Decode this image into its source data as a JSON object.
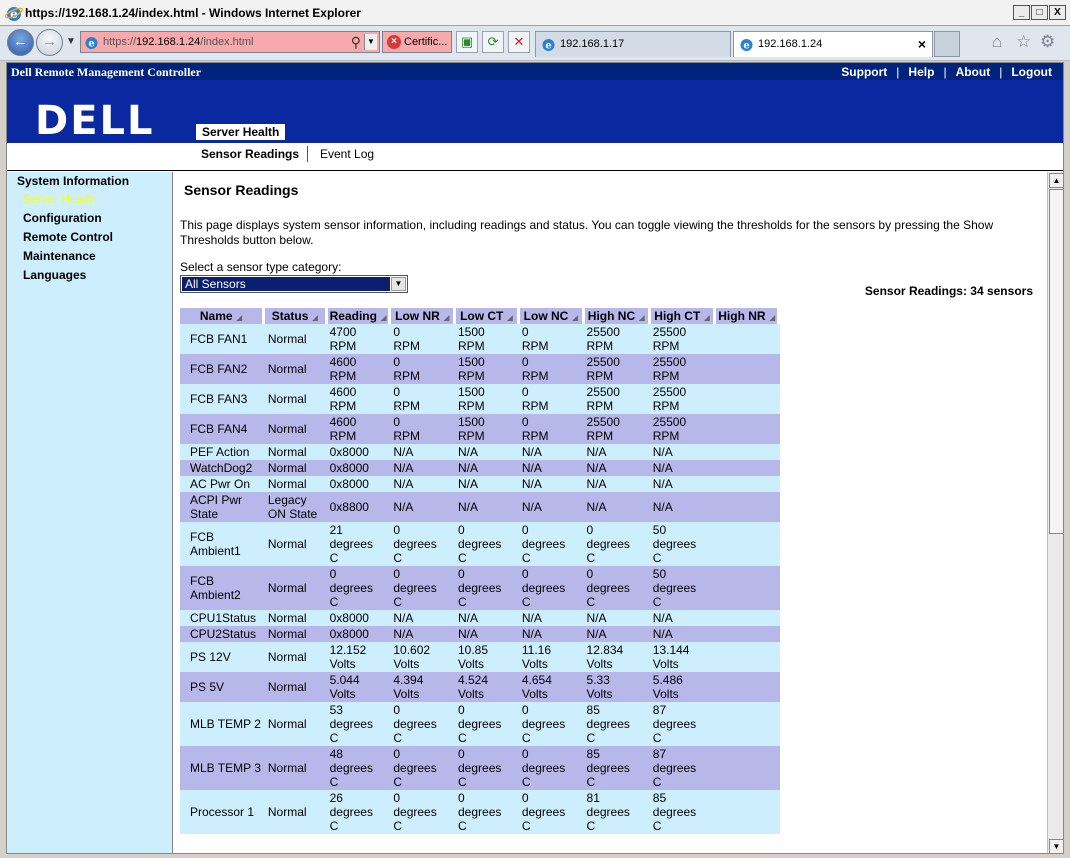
{
  "window": {
    "title": "https://192.168.1.24/index.html - Windows Internet Explorer",
    "minimize": "_",
    "maximize": "□",
    "close": "X"
  },
  "browser": {
    "url_prefix": "https://",
    "url_host": "192.168.1.24",
    "url_path": "/index.html",
    "cert_label": "Certific...",
    "tabs": [
      {
        "label": "192.168.1.17"
      },
      {
        "label": "192.168.1.24"
      }
    ]
  },
  "drmc": {
    "brand": "Dell Remote Management Controller",
    "links": [
      "Support",
      "Help",
      "About",
      "Logout"
    ],
    "logo": "DELL",
    "active_section": "Server Health",
    "subnav": [
      "Sensor Readings",
      "Event Log"
    ]
  },
  "leftnav": [
    {
      "label": "System Information"
    },
    {
      "label": "Server Health"
    },
    {
      "label": "Configuration"
    },
    {
      "label": "Remote Control"
    },
    {
      "label": "Maintenance"
    },
    {
      "label": "Languages"
    }
  ],
  "content": {
    "title": "Sensor Readings",
    "description": "This page displays system sensor information, including readings and status. You can toggle viewing the thresholds for the sensors by pressing the Show Thresholds button below.",
    "select_label": "Select a sensor type category:",
    "select_value": "All Sensors",
    "count_label": "Sensor Readings: 34 sensors"
  },
  "table": {
    "columns": [
      "Name",
      "Status",
      "Reading",
      "Low NR",
      "Low CT",
      "Low NC",
      "High NC",
      "High CT",
      "High NR"
    ],
    "rows": [
      [
        "FCB FAN1",
        "Normal",
        "4700 RPM",
        "0 RPM",
        "1500 RPM",
        "0 RPM",
        "25500 RPM",
        "25500 RPM"
      ],
      [
        "FCB FAN2",
        "Normal",
        "4600 RPM",
        "0 RPM",
        "1500 RPM",
        "0 RPM",
        "25500 RPM",
        "25500 RPM"
      ],
      [
        "FCB FAN3",
        "Normal",
        "4600 RPM",
        "0 RPM",
        "1500 RPM",
        "0 RPM",
        "25500 RPM",
        "25500 RPM"
      ],
      [
        "FCB FAN4",
        "Normal",
        "4600 RPM",
        "0 RPM",
        "1500 RPM",
        "0 RPM",
        "25500 RPM",
        "25500 RPM"
      ],
      [
        "PEF Action",
        "Normal",
        "0x8000",
        "N/A",
        "N/A",
        "N/A",
        "N/A",
        "N/A"
      ],
      [
        "WatchDog2",
        "Normal",
        "0x8000",
        "N/A",
        "N/A",
        "N/A",
        "N/A",
        "N/A"
      ],
      [
        "AC Pwr On",
        "Normal",
        "0x8000",
        "N/A",
        "N/A",
        "N/A",
        "N/A",
        "N/A"
      ],
      [
        "ACPI Pwr State",
        "Legacy ON State",
        "0x8800",
        "N/A",
        "N/A",
        "N/A",
        "N/A",
        "N/A"
      ],
      [
        "FCB Ambient1",
        "Normal",
        "21 degrees C",
        "0 degrees C",
        "0 degrees C",
        "0 degrees C",
        "0 degrees C",
        "50 degrees C"
      ],
      [
        "FCB Ambient2",
        "Normal",
        "0 degrees C",
        "0 degrees C",
        "0 degrees C",
        "0 degrees C",
        "0 degrees C",
        "50 degrees C"
      ],
      [
        "CPU1Status",
        "Normal",
        "0x8000",
        "N/A",
        "N/A",
        "N/A",
        "N/A",
        "N/A"
      ],
      [
        "CPU2Status",
        "Normal",
        "0x8000",
        "N/A",
        "N/A",
        "N/A",
        "N/A",
        "N/A"
      ],
      [
        "PS 12V",
        "Normal",
        "12.152 Volts",
        "10.602 Volts",
        "10.85 Volts",
        "11.16 Volts",
        "12.834 Volts",
        "13.144 Volts"
      ],
      [
        "PS 5V",
        "Normal",
        "5.044 Volts",
        "4.394 Volts",
        "4.524 Volts",
        "4.654 Volts",
        "5.33 Volts",
        "5.486 Volts"
      ],
      [
        "MLB TEMP 2",
        "Normal",
        "53 degrees C",
        "0 degrees C",
        "0 degrees C",
        "0 degrees C",
        "85 degrees C",
        "87 degrees C"
      ],
      [
        "MLB TEMP 3",
        "Normal",
        "48 degrees C",
        "0 degrees C",
        "0 degrees C",
        "0 degrees C",
        "85 degrees C",
        "87 degrees C"
      ],
      [
        "Processor 1",
        "Normal",
        "26 degrees C",
        "0 degrees C",
        "0 degrees C",
        "0 degrees C",
        "81 degrees C",
        "85 degrees C"
      ]
    ]
  }
}
